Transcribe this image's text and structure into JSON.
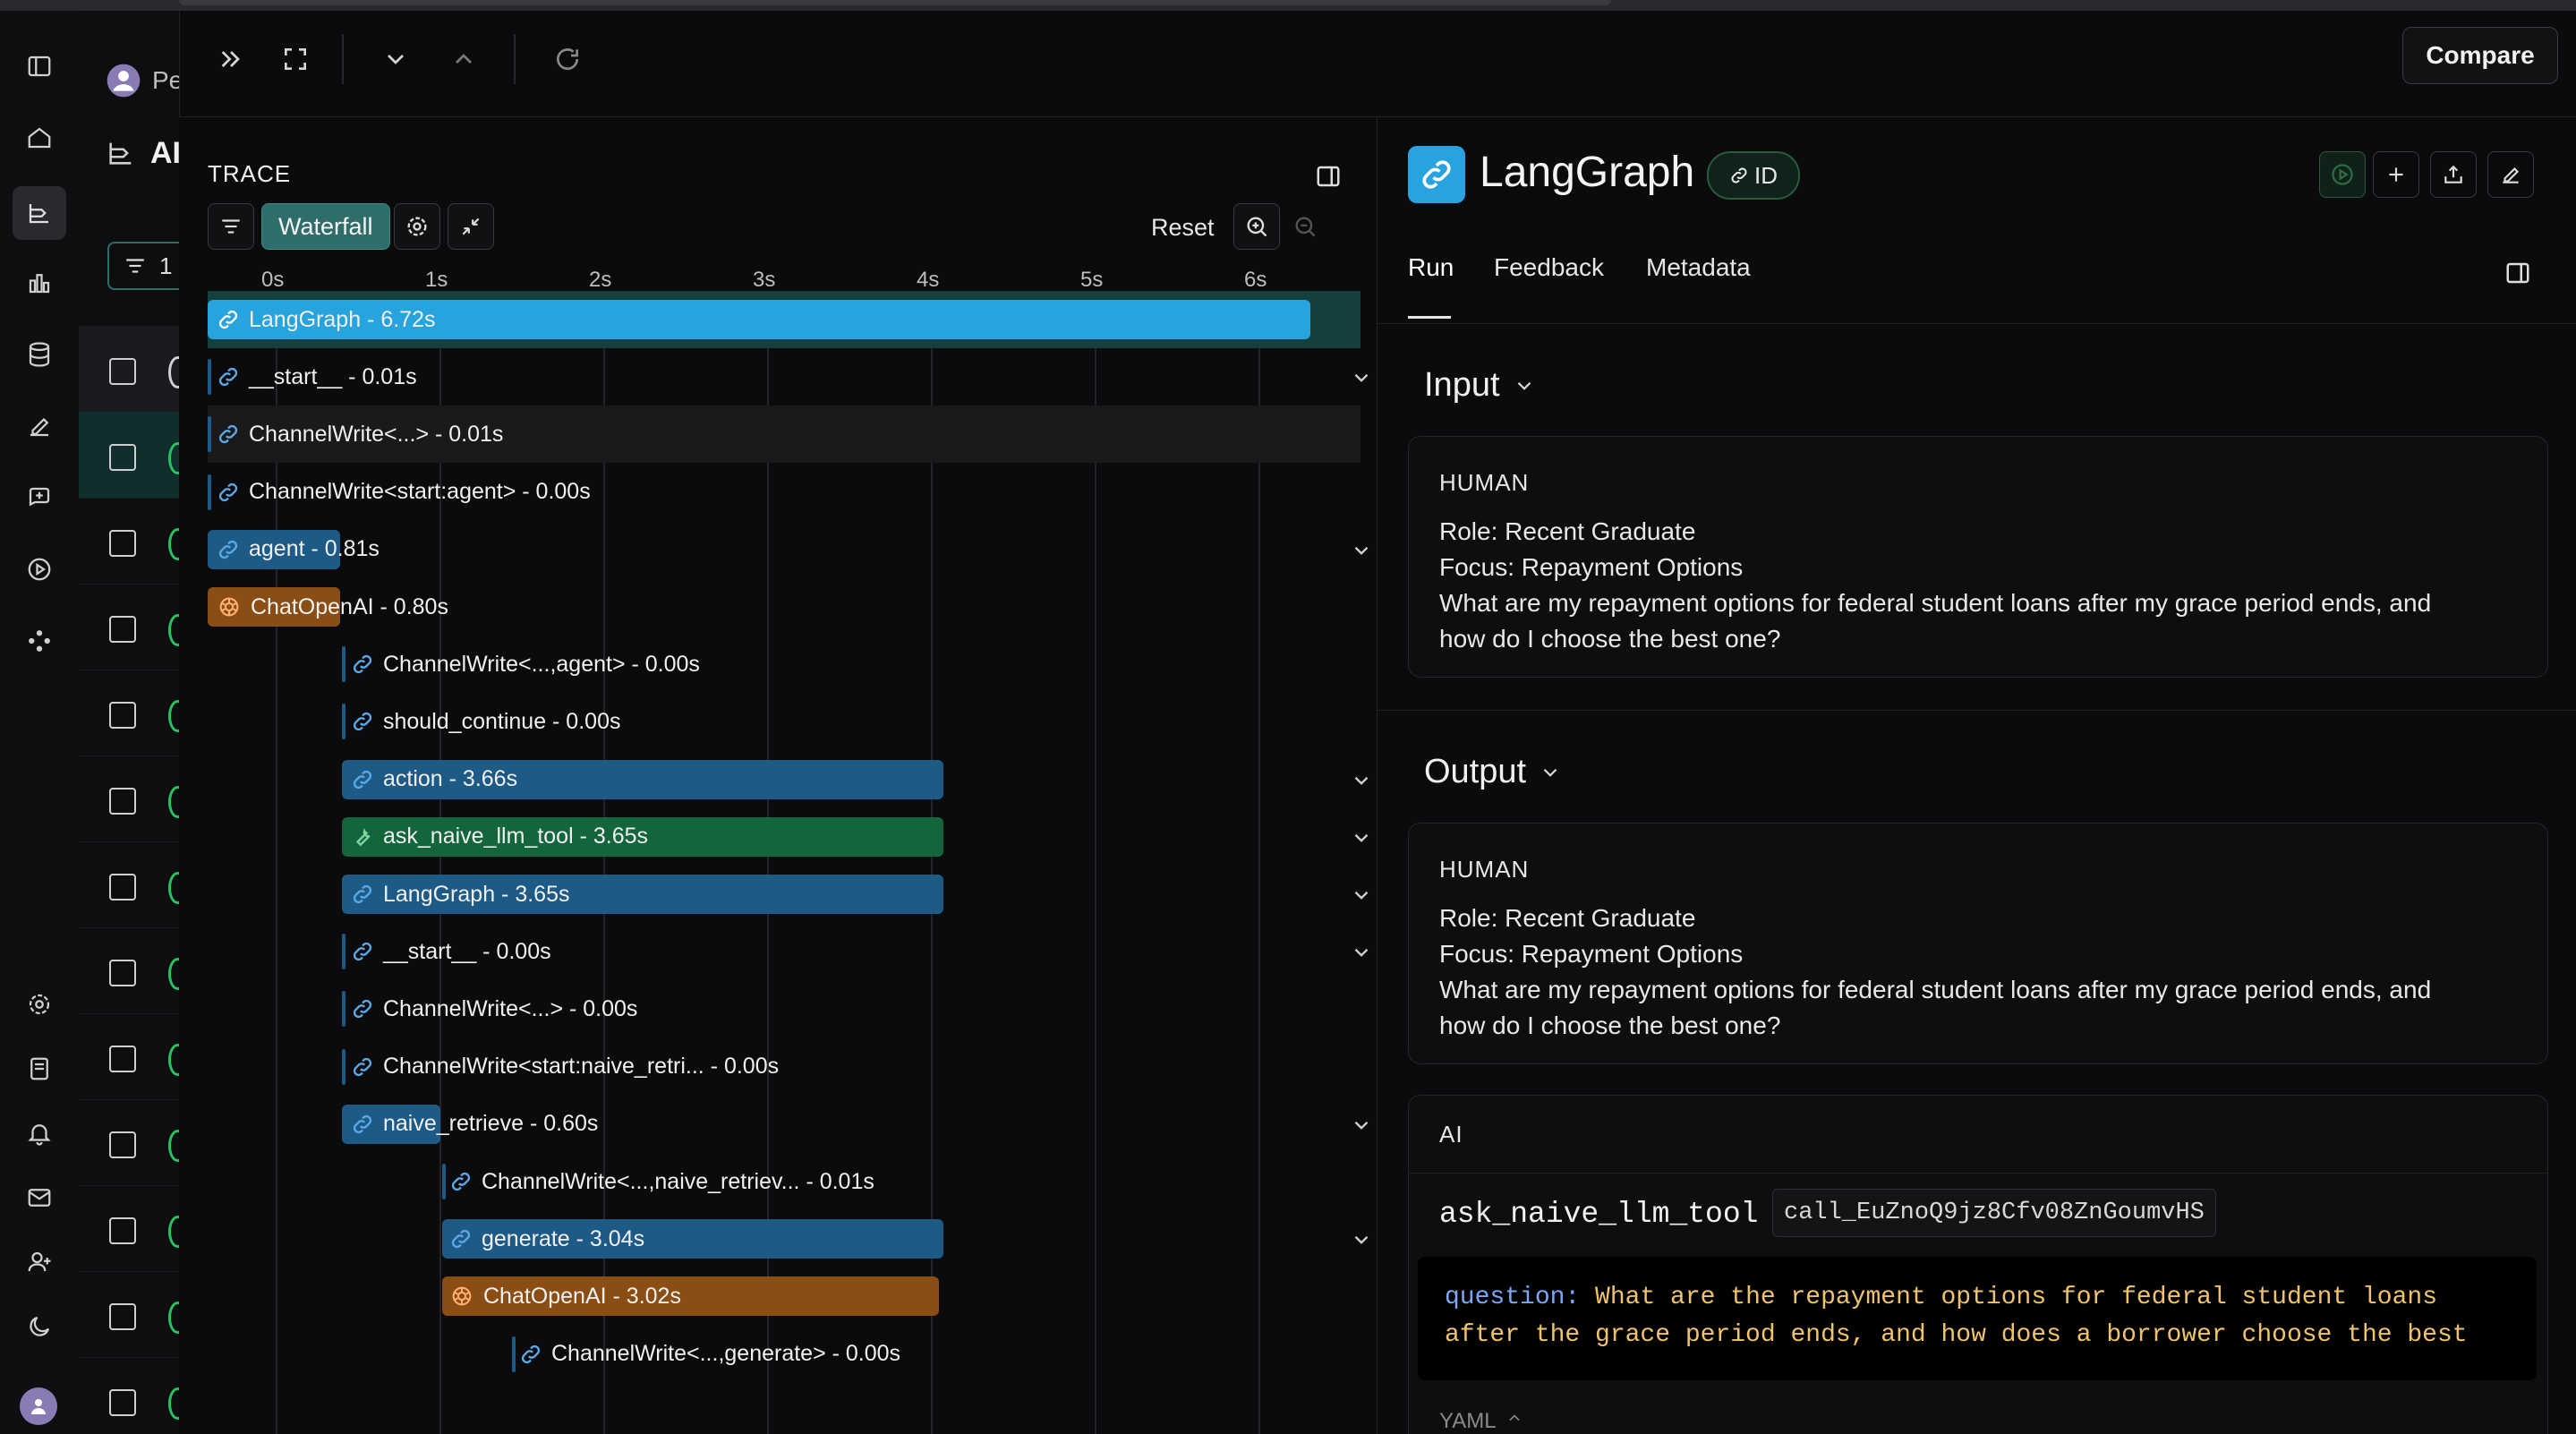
{
  "header": {
    "compare_label": "Compare",
    "list_title_partial": "AI",
    "user_partial": "Pe",
    "filter_count_partial": "1"
  },
  "trace": {
    "title": "TRACE",
    "waterfall_label": "Waterfall",
    "reset_label": "Reset",
    "axis_ticks": [
      "0s",
      "1s",
      "2s",
      "3s",
      "4s",
      "5s",
      "6s"
    ],
    "rows": [
      {
        "label": "LangGraph - 6.72s",
        "kind": "chain",
        "state": "selected"
      },
      {
        "label": "__start__ - 0.01s",
        "kind": "chain",
        "expandable": true
      },
      {
        "label": "ChannelWrite<...> - 0.01s",
        "kind": "chain",
        "state": "hover"
      },
      {
        "label": "ChannelWrite<start:agent> - 0.00s",
        "kind": "chain"
      },
      {
        "label": "agent - 0.81s",
        "kind": "chain",
        "expandable": true
      },
      {
        "label": "ChatOpenAI - 0.80s",
        "kind": "llm"
      },
      {
        "label": "ChannelWrite<...,agent> - 0.00s",
        "kind": "chain"
      },
      {
        "label": "should_continue - 0.00s",
        "kind": "chain"
      },
      {
        "label": "action - 3.66s",
        "kind": "chain",
        "expandable": true
      },
      {
        "label": "ask_naive_llm_tool - 3.65s",
        "kind": "tool",
        "expandable": true
      },
      {
        "label": "LangGraph - 3.65s",
        "kind": "chain",
        "expandable": true
      },
      {
        "label": "__start__ - 0.00s",
        "kind": "chain",
        "expandable": true
      },
      {
        "label": "ChannelWrite<...> - 0.00s",
        "kind": "chain"
      },
      {
        "label": "ChannelWrite<start:naive_retri... - 0.00s",
        "kind": "chain"
      },
      {
        "label": "naive_retrieve - 0.60s",
        "kind": "chain",
        "expandable": true
      },
      {
        "label": "ChannelWrite<...,naive_retriev... - 0.01s",
        "kind": "chain"
      },
      {
        "label": "generate - 3.04s",
        "kind": "chain",
        "expandable": true
      },
      {
        "label": "ChatOpenAI - 3.02s",
        "kind": "llm"
      },
      {
        "label": "ChannelWrite<...,generate> - 0.00s",
        "kind": "chain"
      }
    ]
  },
  "detail": {
    "title": "LangGraph",
    "id_badge": "ID",
    "tabs": [
      "Run",
      "Feedback",
      "Metadata"
    ],
    "input": {
      "heading": "Input",
      "role": "HUMAN",
      "line1": "Role: Recent Graduate",
      "line2": "Focus: Repayment Options",
      "line3": "What are my repayment options for federal student loans after my grace period ends, and",
      "line4": "how do I choose the best one?"
    },
    "output": {
      "heading": "Output",
      "role": "HUMAN",
      "line1": "Role: Recent Graduate",
      "line2": "Focus: Repayment Options",
      "line3": "What are my repayment options for federal student loans after my grace period ends, and",
      "line4": "how do I choose the best one?",
      "ai_role": "AI",
      "tool_name": "ask_naive_llm_tool",
      "call_id": "call_EuZnoQ9jz8Cfv08ZnGoumvHS",
      "code_key": "question:",
      "code_line1": " What are the repayment options for federal student loans",
      "code_line2": "after the grace period ends, and how does a borrower choose the best",
      "yaml_label": "YAML"
    }
  },
  "colors": {
    "chain_bar": "#1e5a86",
    "root_bar": "#27a3de",
    "tool_bar": "#13653b",
    "llm_bar": "#8a4d14",
    "accent_teal": "#2f6d6a"
  }
}
